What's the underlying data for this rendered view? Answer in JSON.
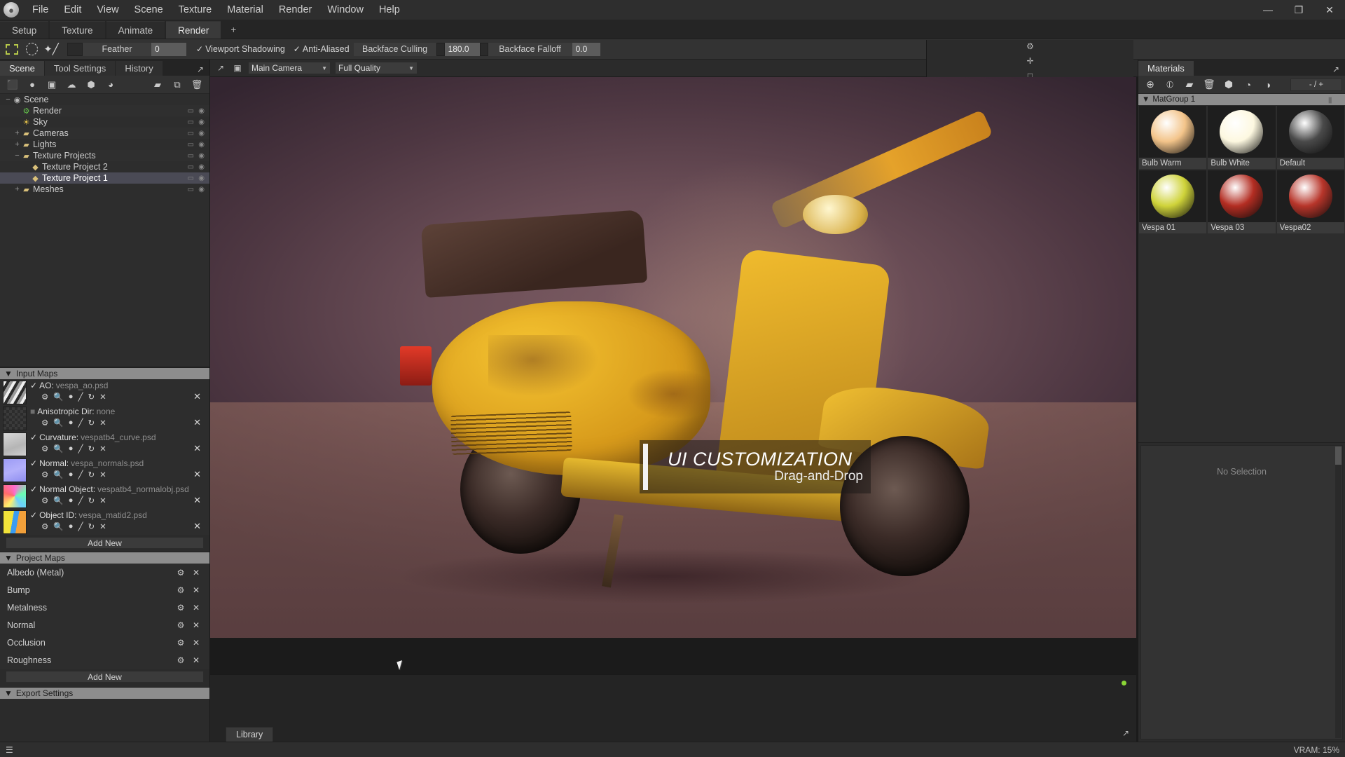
{
  "titlebar": {
    "logo_icon": "app-logo-icon",
    "menus": [
      "File",
      "Edit",
      "View",
      "Scene",
      "Texture",
      "Material",
      "Render",
      "Window",
      "Help"
    ],
    "window_buttons": [
      {
        "name": "minimize-button",
        "glyph": "—"
      },
      {
        "name": "maximize-button",
        "glyph": "❐"
      },
      {
        "name": "close-button",
        "glyph": "✕"
      }
    ]
  },
  "workspace_tabs": {
    "tabs": [
      "Setup",
      "Texture",
      "Animate",
      "Render"
    ],
    "active": "Render",
    "add_label": "+"
  },
  "toolbar": {
    "tools": [
      {
        "name": "marquee-rect-tool",
        "label": "Rectangle Marquee"
      },
      {
        "name": "marquee-ellipse-tool",
        "label": "Ellipse Marquee"
      },
      {
        "name": "magic-wand-tool",
        "label": "Magic Wand"
      }
    ],
    "feather_label": "Feather",
    "feather_value": "0",
    "viewport_shadowing": "Viewport Shadowing",
    "anti_aliased": "Anti-Aliased",
    "backface_culling_label": "Backface Culling",
    "backface_culling_value": "180.0",
    "backface_falloff_label": "Backface Falloff",
    "backface_falloff_value": "0.0"
  },
  "left_panel": {
    "tabs": [
      "Scene",
      "Tool Settings",
      "History"
    ],
    "active_tab": "Scene",
    "expand_icon": "expand-panel-icon",
    "outliner_tools": [
      {
        "name": "add-mesh-icon",
        "glyph": "⬛"
      },
      {
        "name": "add-light-icon",
        "glyph": "●"
      },
      {
        "name": "add-camera-icon",
        "glyph": "▣"
      },
      {
        "name": "add-sky-icon",
        "glyph": "☁"
      },
      {
        "name": "add-object-icon",
        "glyph": "⬢"
      },
      {
        "name": "add-material-icon",
        "glyph": "◕"
      },
      {
        "name": "new-folder-icon",
        "glyph": "▰"
      },
      {
        "name": "duplicate-icon",
        "glyph": "⧉"
      },
      {
        "name": "delete-icon",
        "glyph": "🗑"
      }
    ],
    "tree": [
      {
        "label": "Scene",
        "depth": 0,
        "twisty": "−",
        "icon": "scene-icon",
        "selected": false
      },
      {
        "label": "Render",
        "depth": 1,
        "twisty": "",
        "icon": "render-gear-icon",
        "selected": false
      },
      {
        "label": "Sky",
        "depth": 1,
        "twisty": "",
        "icon": "sky-icon",
        "selected": false
      },
      {
        "label": "Cameras",
        "depth": 1,
        "twisty": "+",
        "icon": "folder-icon",
        "selected": false
      },
      {
        "label": "Lights",
        "depth": 1,
        "twisty": "+",
        "icon": "folder-icon",
        "selected": false
      },
      {
        "label": "Texture Projects",
        "depth": 1,
        "twisty": "−",
        "icon": "folder-icon",
        "selected": false
      },
      {
        "label": "Texture Project 2",
        "depth": 2,
        "twisty": "",
        "icon": "project-icon",
        "selected": false
      },
      {
        "label": "Texture Project 1",
        "depth": 2,
        "twisty": "",
        "icon": "project-icon",
        "selected": true
      },
      {
        "label": "Meshes",
        "depth": 1,
        "twisty": "+",
        "icon": "folder-icon",
        "selected": false
      }
    ],
    "input_maps": {
      "title": "Input Maps",
      "rows": [
        {
          "checked": true,
          "key": "AO:",
          "value": "vespa_ao.psd",
          "thumb": "ao-thumb"
        },
        {
          "checked": false,
          "key": "Anisotropic Dir:",
          "value": "none",
          "thumb": "aniso-thumb"
        },
        {
          "checked": true,
          "key": "Curvature:",
          "value": "vespatb4_curve.psd",
          "thumb": "curvature-thumb"
        },
        {
          "checked": true,
          "key": "Normal:",
          "value": "vespa_normals.psd",
          "thumb": "normal-thumb"
        },
        {
          "checked": true,
          "key": "Normal Object:",
          "value": "vespatb4_normalobj.psd",
          "thumb": "normalobj-thumb"
        },
        {
          "checked": true,
          "key": "Object ID:",
          "value": "vespa_matid2.psd",
          "thumb": "objectid-thumb"
        }
      ],
      "row_icons": [
        {
          "name": "settings-gear-icon",
          "glyph": "⚙"
        },
        {
          "name": "zoom-icon",
          "glyph": "🔍"
        },
        {
          "name": "color-picker-icon",
          "glyph": "●"
        },
        {
          "name": "eyedropper-icon",
          "glyph": "╱"
        },
        {
          "name": "reload-icon",
          "glyph": "↻"
        },
        {
          "name": "clear-icon",
          "glyph": "✕"
        }
      ],
      "remove_icon": "✕",
      "add_new_label": "Add New"
    },
    "project_maps": {
      "title": "Project Maps",
      "rows": [
        "Albedo (Metal)",
        "Bump",
        "Metalness",
        "Normal",
        "Occlusion",
        "Roughness"
      ],
      "gear_icon": "⚙",
      "close_icon": "✕",
      "add_new_label": "Add New"
    },
    "export_settings_title": "Export Settings"
  },
  "viewport": {
    "expand_icon": "pop-out-icon",
    "camera_icon": "camera-icon",
    "camera_value": "Main Camera",
    "quality_value": "Full Quality",
    "header_right_icons": [
      {
        "name": "viewport-settings-gear-icon",
        "glyph": "⚙"
      },
      {
        "name": "fit-view-icon",
        "glyph": "✛"
      },
      {
        "name": "maximize-viewport-icon",
        "glyph": "□"
      },
      {
        "name": "pop-out-viewport-icon",
        "glyph": "↗"
      }
    ],
    "overlay": {
      "title": "UI CUSTOMIZATION",
      "subtitle": "Drag-and-Drop"
    },
    "library_tab": "Library",
    "footer_icon": "pop-out-icon",
    "status_dot_color": "#8bd636"
  },
  "right_panel": {
    "tab_label": "Materials",
    "expand_icon": "pop-out-icon",
    "toolbar_icons": [
      {
        "name": "add-material-icon",
        "glyph": "⊕"
      },
      {
        "name": "add-material-copy-icon",
        "glyph": "⦶"
      },
      {
        "name": "new-group-folder-icon",
        "glyph": "▰"
      },
      {
        "name": "delete-material-icon",
        "glyph": "🗑"
      },
      {
        "name": "assign-material-icon",
        "glyph": "⬢"
      },
      {
        "name": "select-by-material-icon",
        "glyph": "◔"
      },
      {
        "name": "material-picker-icon",
        "glyph": "◑"
      }
    ],
    "count_value": "- / +",
    "group_name": "MatGroup 1",
    "materials": [
      {
        "name": "Bulb Warm",
        "color": "#f3c48a"
      },
      {
        "name": "Bulb White",
        "color": "#fdf8e0"
      },
      {
        "name": "Default",
        "color": "#4a4a4a"
      },
      {
        "name": "Vespa 01",
        "color": "#cfd33a"
      },
      {
        "name": "Vespa 03",
        "color": "#b32d22"
      },
      {
        "name": "Vespa02",
        "color": "#b7352a"
      }
    ],
    "no_selection_label": "No Selection"
  },
  "statusbar": {
    "menu_icon": "hamburger-icon",
    "vram_label": "VRAM: 15%"
  }
}
